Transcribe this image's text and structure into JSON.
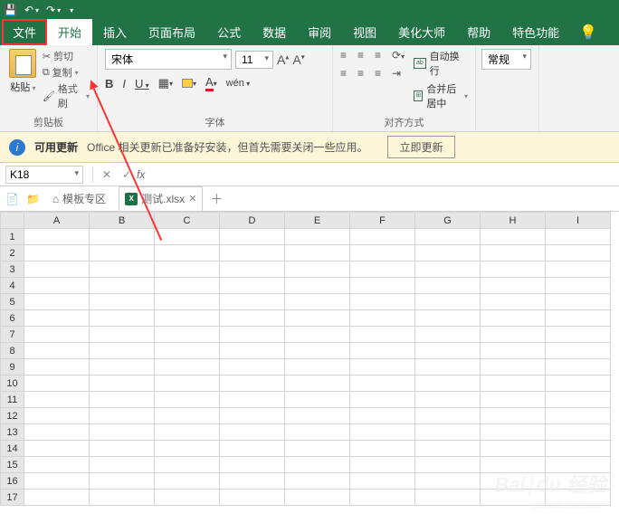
{
  "qat": {
    "save": "💾",
    "undo": "↶",
    "redo": "↷"
  },
  "tabs": {
    "file": "文件",
    "home": "开始",
    "insert": "插入",
    "layout": "页面布局",
    "formula": "公式",
    "data": "数据",
    "review": "审阅",
    "view": "视图",
    "beautify": "美化大师",
    "help": "帮助",
    "special": "特色功能"
  },
  "clipboard": {
    "paste": "粘贴",
    "cut": "剪切",
    "copy": "复制",
    "format_painter": "格式刷",
    "group_label": "剪贴板"
  },
  "font": {
    "name": "宋体",
    "size": "11",
    "bold": "B",
    "italic": "I",
    "underline": "U",
    "group_label": "字体"
  },
  "align": {
    "wrap": "自动换行",
    "merge": "合并后居中",
    "group_label": "对齐方式"
  },
  "number": {
    "format": "常规"
  },
  "update_bar": {
    "title": "可用更新",
    "text": "Office 相关更新已准备好安装，但首先需要关闭一些应用。",
    "button": "立即更新"
  },
  "namebox": {
    "ref": "K18",
    "fx": "fx"
  },
  "doc_tabs": {
    "template": "模板专区",
    "file1": "测试.xlsx"
  },
  "columns": [
    "A",
    "B",
    "C",
    "D",
    "E",
    "F",
    "G",
    "H",
    "I"
  ],
  "rows": [
    "1",
    "2",
    "3",
    "4",
    "5",
    "6",
    "7",
    "8",
    "9",
    "10",
    "11",
    "12",
    "13",
    "14",
    "15",
    "16",
    "17"
  ],
  "watermark": {
    "main": "Bai׀du 经验",
    "sub": "jingyan.baidu.com"
  }
}
